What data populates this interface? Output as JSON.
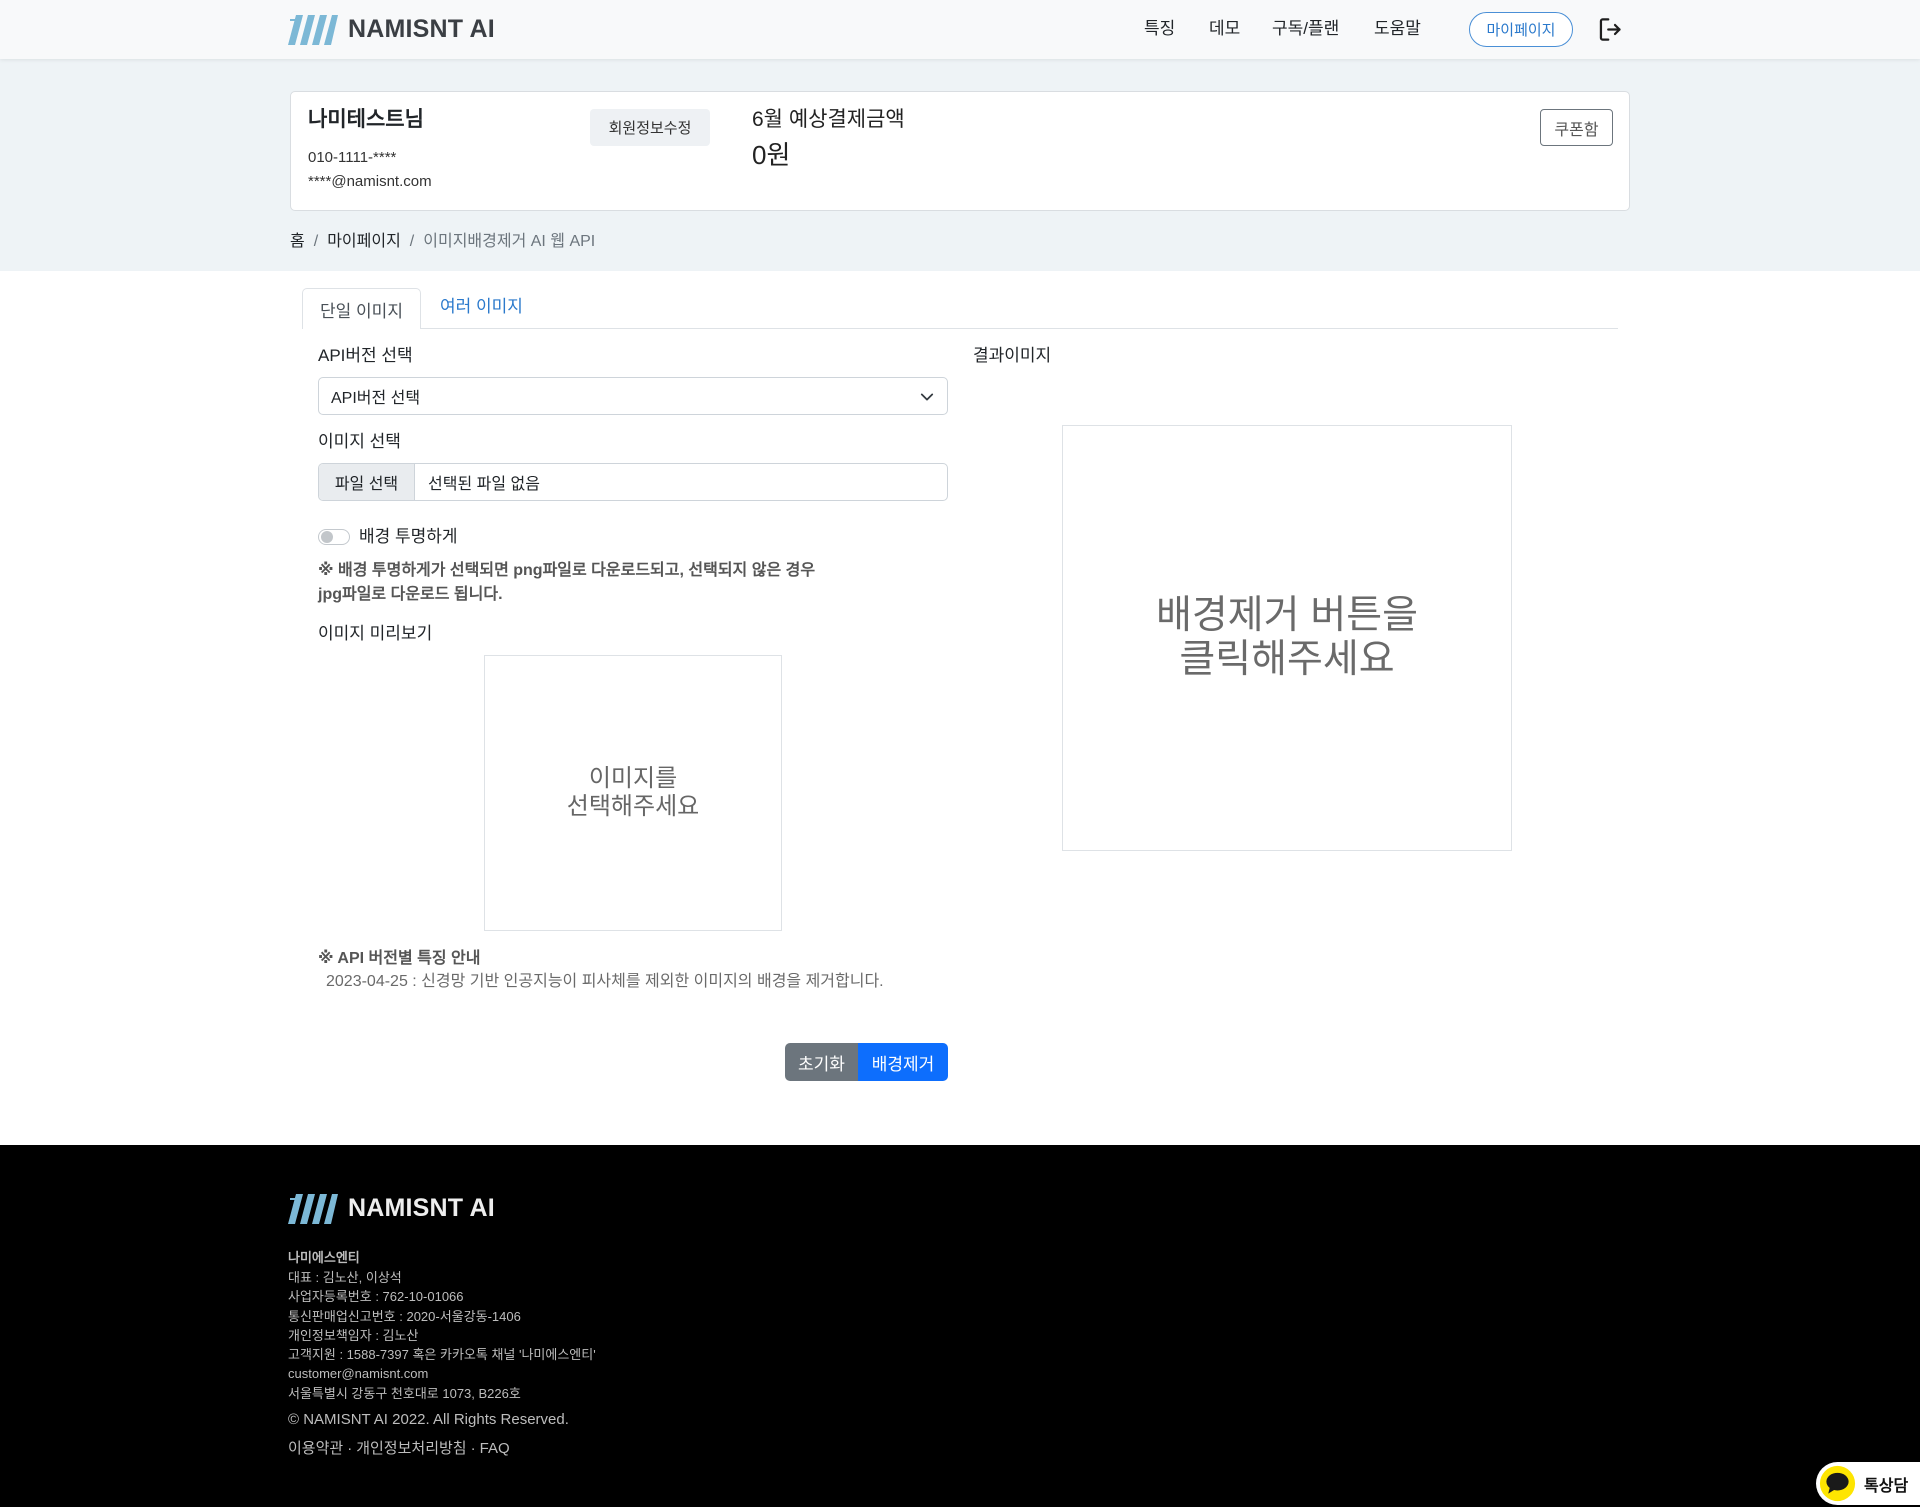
{
  "header": {
    "brand": "NAMISNT AI",
    "nav": [
      "특징",
      "데모",
      "구독/플랜",
      "도움말"
    ],
    "mypage_button": "마이페이지",
    "logout_icon": "logout-icon"
  },
  "account": {
    "name": "나미테스트님",
    "phone": "010-1111-****",
    "email": "****@namisnt.com",
    "edit_button": "회원정보수정",
    "payment_label": "6월 예상결제금액",
    "payment_amount": "0원",
    "coupon_button": "쿠폰함"
  },
  "breadcrumb": {
    "separator": "/",
    "items": [
      "홈",
      "마이페이지",
      "이미지배경제거 AI 웹 API"
    ]
  },
  "tabs": [
    {
      "label": "단일 이미지",
      "active": true
    },
    {
      "label": "여러 이미지",
      "active": false
    }
  ],
  "form": {
    "api_version_label": "API버전 선택",
    "api_version_selected": "API버전 선택",
    "image_label": "이미지 선택",
    "file_button": "파일 선택",
    "file_status": "선택된 파일 없음",
    "transparent_label": "배경 투명하게",
    "transparent_on": false,
    "transparent_note": [
      "※ 배경 투명하게가 선택되면 png파일로 다운로드되고, 선택되지 않은 경우",
      "jpg파일로 다운로드 됩니다."
    ],
    "preview_label": "이미지 미리보기",
    "preview_placeholder": [
      "이미지를",
      "선택해주세요"
    ],
    "api_notes_title": "※ API 버전별 특징 안내",
    "api_notes": [
      "2023-04-25 : 신경망 기반 인공지능이 피사체를 제외한 이미지의 배경을 제거합니다."
    ],
    "reset_button": "초기화",
    "remove_bg_button": "배경제거"
  },
  "result": {
    "label": "결과이미지",
    "placeholder": [
      "배경제거 버튼을",
      "클릭해주세요"
    ]
  },
  "footer": {
    "brand": "NAMISNT AI",
    "company": "나미에스엔티",
    "lines": [
      "대표 : 김노산, 이상석",
      "사업자등록번호 : 762-10-01066",
      "통신판매업신고번호 : 2020-서울강동-1406",
      "개인정보책임자 : 김노산",
      "고객지원 : 1588-7397 혹은 카카오톡 채널 '나미에스엔티'",
      "customer@namisnt.com",
      "서울특별시 강동구 천호대로 1073, B226호"
    ],
    "copyright": "© NAMISNT AI 2022. All Rights Reserved.",
    "links": [
      "이용약관",
      "개인정보처리방침",
      "FAQ"
    ],
    "link_separator": "·"
  },
  "chat_widget": {
    "label": "톡상담",
    "icon": "chat-bubble-icon"
  },
  "colors": {
    "primary": "#0d6efd",
    "secondary": "#6c757d",
    "link": "#2a79cc",
    "logo": "#7cb8d6",
    "band_bg": "#eef3f6",
    "footer_bg": "#000000",
    "chat_yellow": "#fee500"
  }
}
